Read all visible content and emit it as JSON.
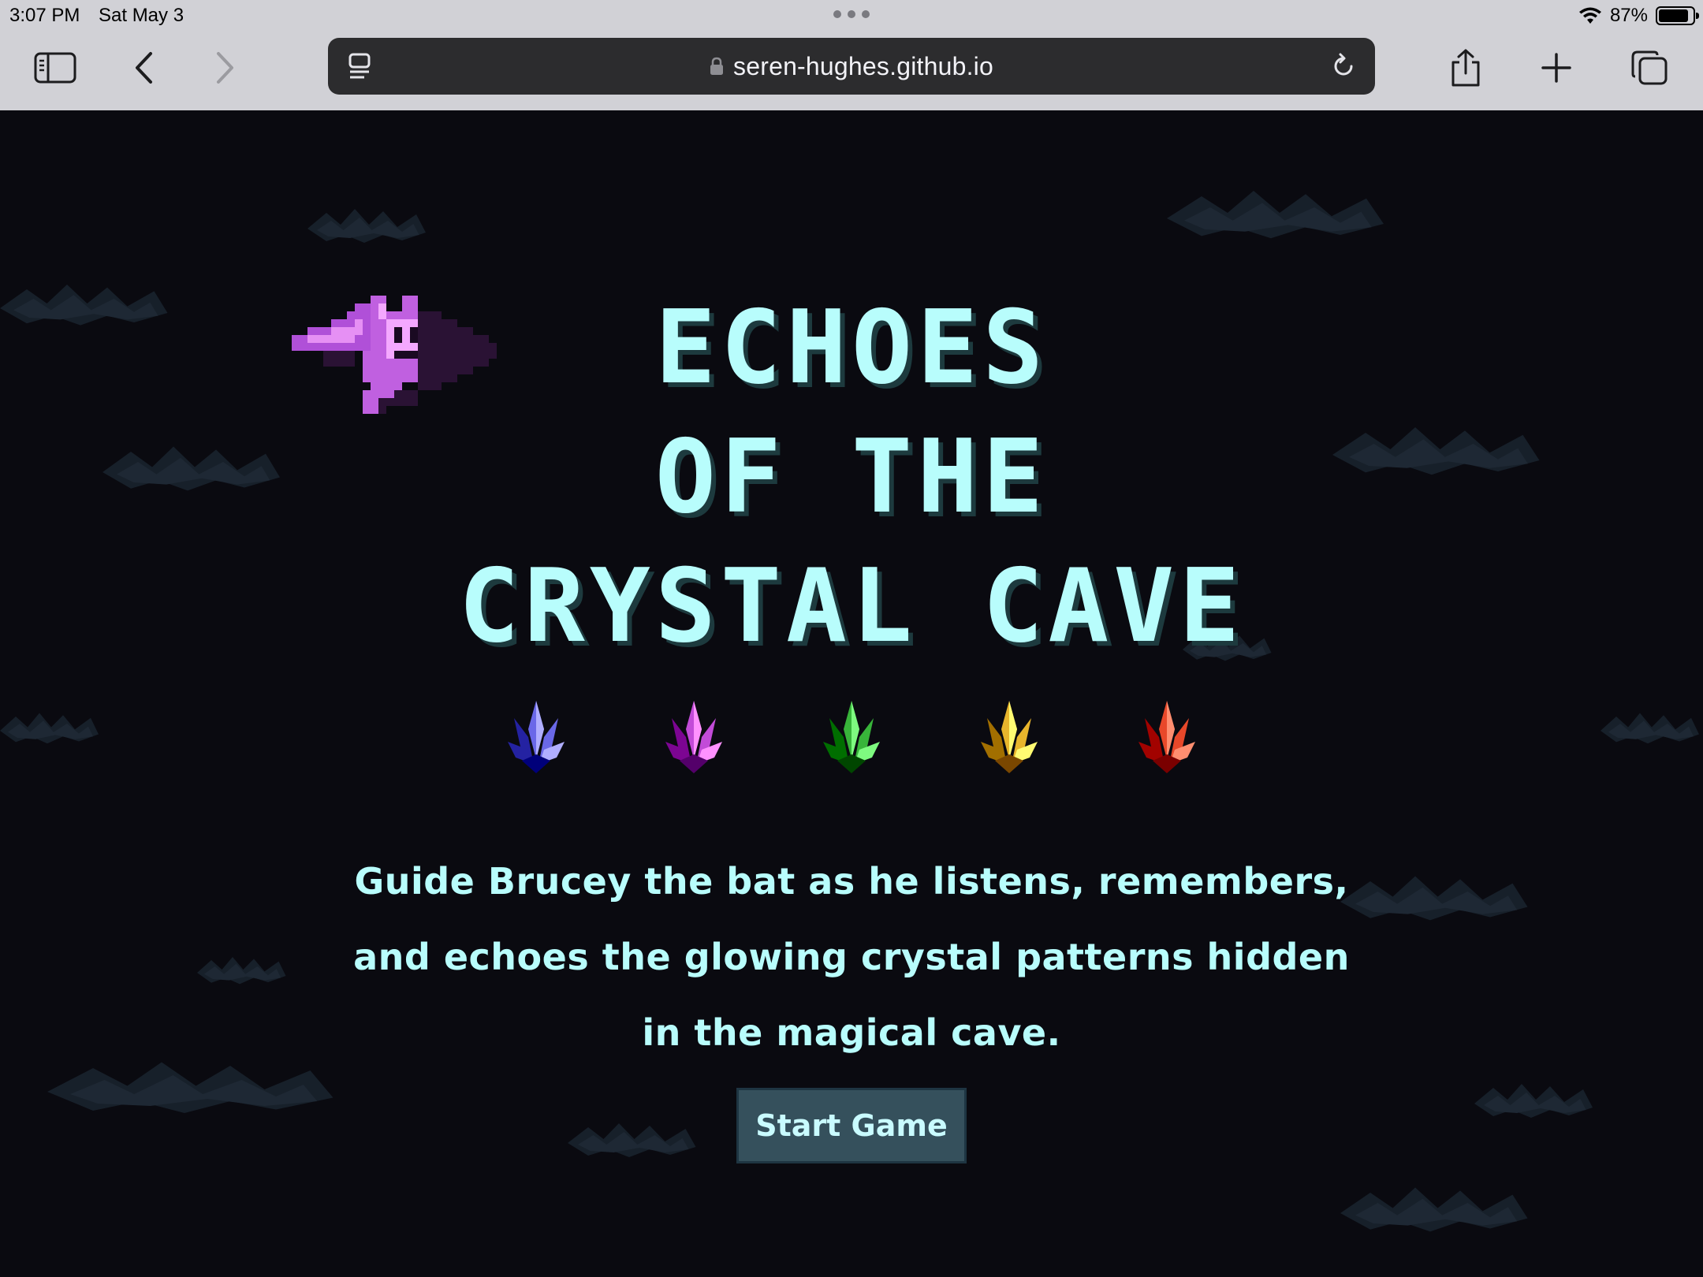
{
  "status_bar": {
    "time": "3:07 PM",
    "date": "Sat May 3",
    "battery_percent": "87%",
    "battery_level": 0.87
  },
  "browser": {
    "url": "seren-hughes.github.io",
    "icons": {
      "sidebar": "sidebar-icon",
      "back": "chevron-left-icon",
      "forward": "chevron-right-icon",
      "reader": "reader-icon",
      "lock": "lock-icon",
      "reload": "reload-icon",
      "share": "share-icon",
      "new_tab": "plus-icon",
      "tabs": "tabs-icon"
    }
  },
  "game": {
    "title_lines": [
      "ECHOES",
      "OF THE",
      "CRYSTAL CAVE"
    ],
    "description": "Guide Brucey the bat as he listens, remembers, and echoes the glowing crystal patterns hidden in the magical cave.",
    "start_button": "Start Game",
    "crystals": [
      {
        "name": "blue",
        "color": "#6a68e8"
      },
      {
        "name": "purple",
        "color": "#c24bd8"
      },
      {
        "name": "green",
        "color": "#38b43a"
      },
      {
        "name": "yellow",
        "color": "#e8b52c"
      },
      {
        "name": "red",
        "color": "#e8482a"
      }
    ],
    "colors": {
      "title": "#b8fdfc",
      "bat": "#c060e0",
      "background": "#0a0a10",
      "button": "#35505c"
    }
  }
}
